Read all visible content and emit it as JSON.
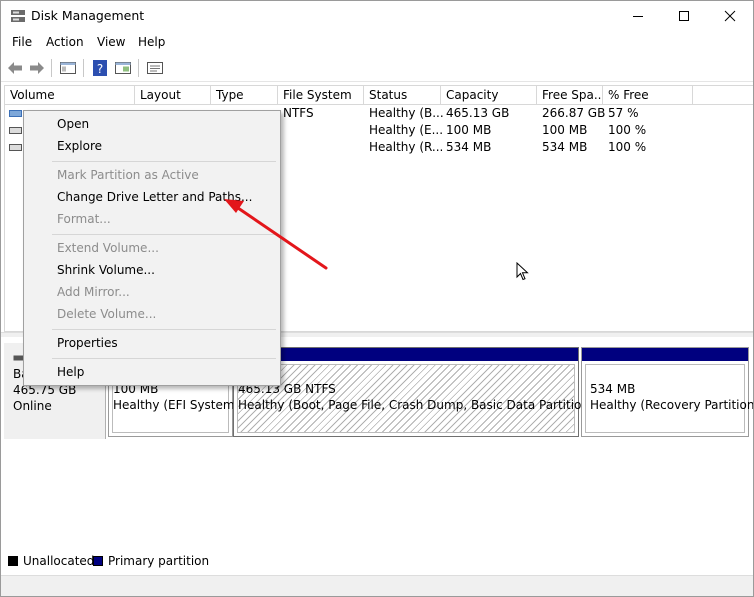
{
  "window": {
    "title": "Disk Management"
  },
  "menu": [
    "File",
    "Action",
    "View",
    "Help"
  ],
  "columns": [
    "Volume",
    "Layout",
    "Type",
    "File System",
    "Status",
    "Capacity",
    "Free Spa...",
    "% Free"
  ],
  "rows": [
    {
      "file_system": "NTFS",
      "status": "Healthy (B...",
      "capacity": "465.13 GB",
      "free": "266.87 GB",
      "pct": "57 %"
    },
    {
      "file_system": "",
      "status": "Healthy (E...",
      "capacity": "100 MB",
      "free": "100 MB",
      "pct": "100 %"
    },
    {
      "file_system": "",
      "status": "Healthy (R...",
      "capacity": "534 MB",
      "free": "534 MB",
      "pct": "100 %"
    }
  ],
  "disk": {
    "name": "Ba",
    "size": "465.75 GB",
    "state": "Online"
  },
  "partitions": [
    {
      "size": "100 MB",
      "status": "Healthy (EFI System"
    },
    {
      "size": "465.13 GB NTFS",
      "status": "Healthy (Boot, Page File, Crash Dump, Basic Data Partition)"
    },
    {
      "size": "534 MB",
      "status": "Healthy (Recovery Partition)"
    }
  ],
  "legend": {
    "unallocated": "Unallocated",
    "primary": "Primary partition"
  },
  "context_menu": {
    "open": "Open",
    "explore": "Explore",
    "mark_active": "Mark Partition as Active",
    "change_letter": "Change Drive Letter and Paths...",
    "format": "Format...",
    "extend": "Extend Volume...",
    "shrink": "Shrink Volume...",
    "add_mirror": "Add Mirror...",
    "delete": "Delete Volume...",
    "properties": "Properties",
    "help": "Help"
  },
  "colors": {
    "primary_partition": "#00007f",
    "unallocated": "#000000",
    "annotation_arrow": "#e3161b"
  }
}
